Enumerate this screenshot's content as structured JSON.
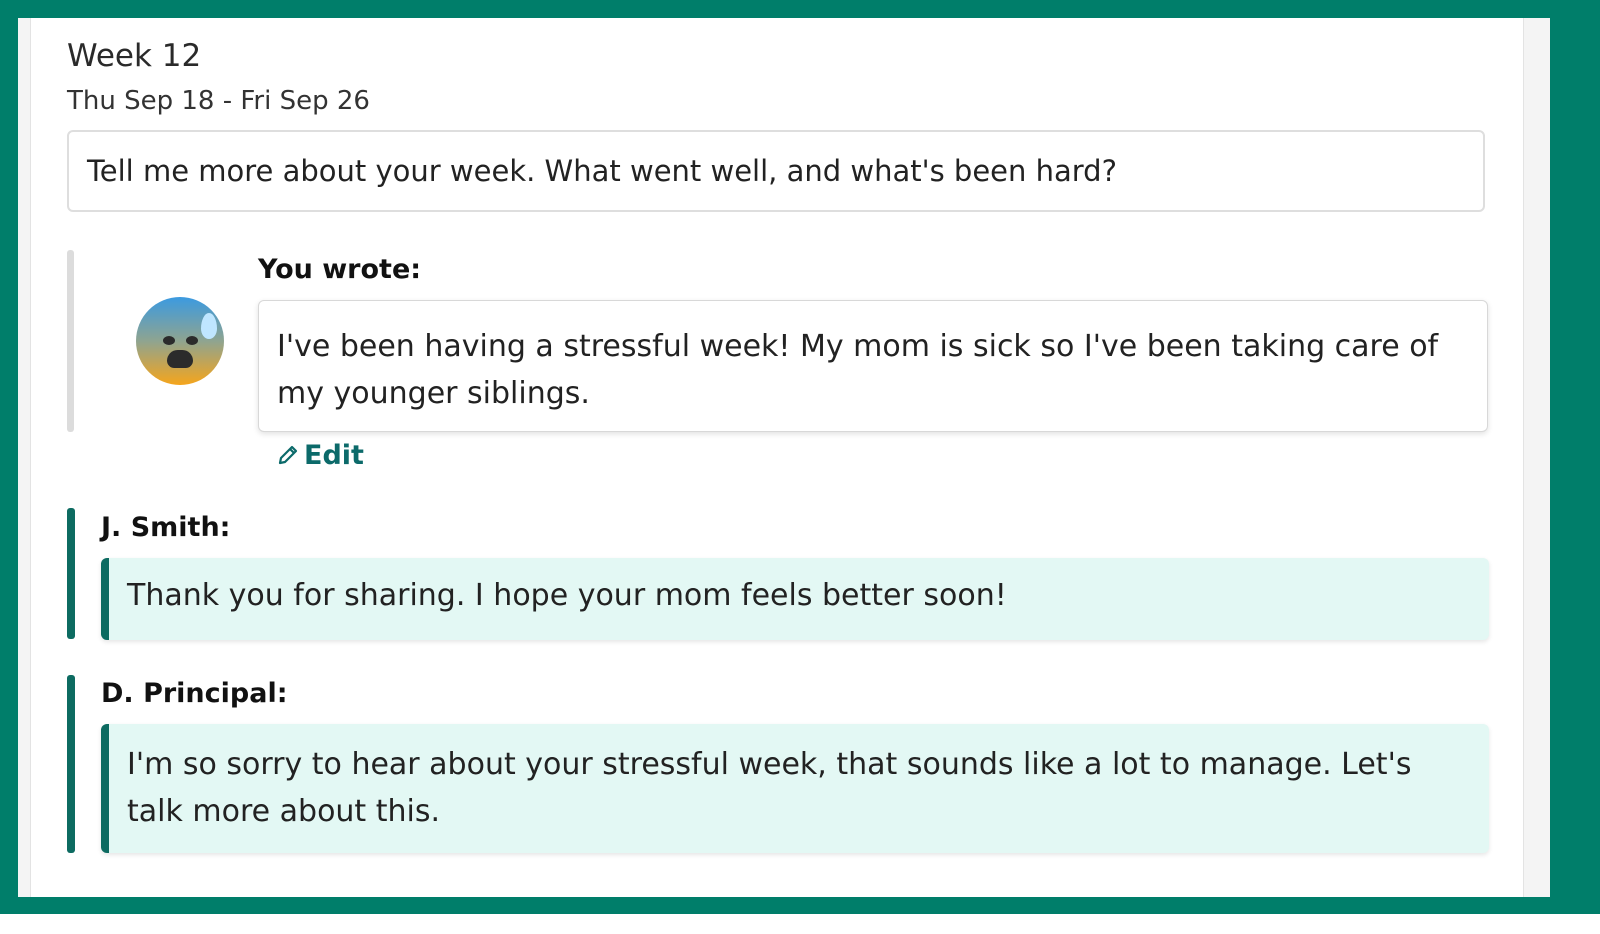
{
  "week": {
    "title": "Week 12",
    "range": "Thu Sep 18 - Fri Sep 26"
  },
  "prompt": "Tell me more about your week. What went well, and what's been hard?",
  "self_response": {
    "label": "You wrote:",
    "mood_icon": "anxious-sweat-face-icon",
    "text": "I've been having a stressful week! My mom is sick so I've been taking care of my younger siblings.",
    "edit_label": "Edit"
  },
  "replies": [
    {
      "author": "J. Smith:",
      "text": "Thank you for sharing. I hope your mom feels better soon!"
    },
    {
      "author": "D. Principal:",
      "text": "I'm so sorry to hear about your stressful week, that sounds like a lot to manage. Let's talk more about this."
    }
  ],
  "colors": {
    "frame": "#007e6a",
    "accent": "#0d6b61",
    "reply_background": "#e3f8f4",
    "link": "#0c6a6a"
  }
}
